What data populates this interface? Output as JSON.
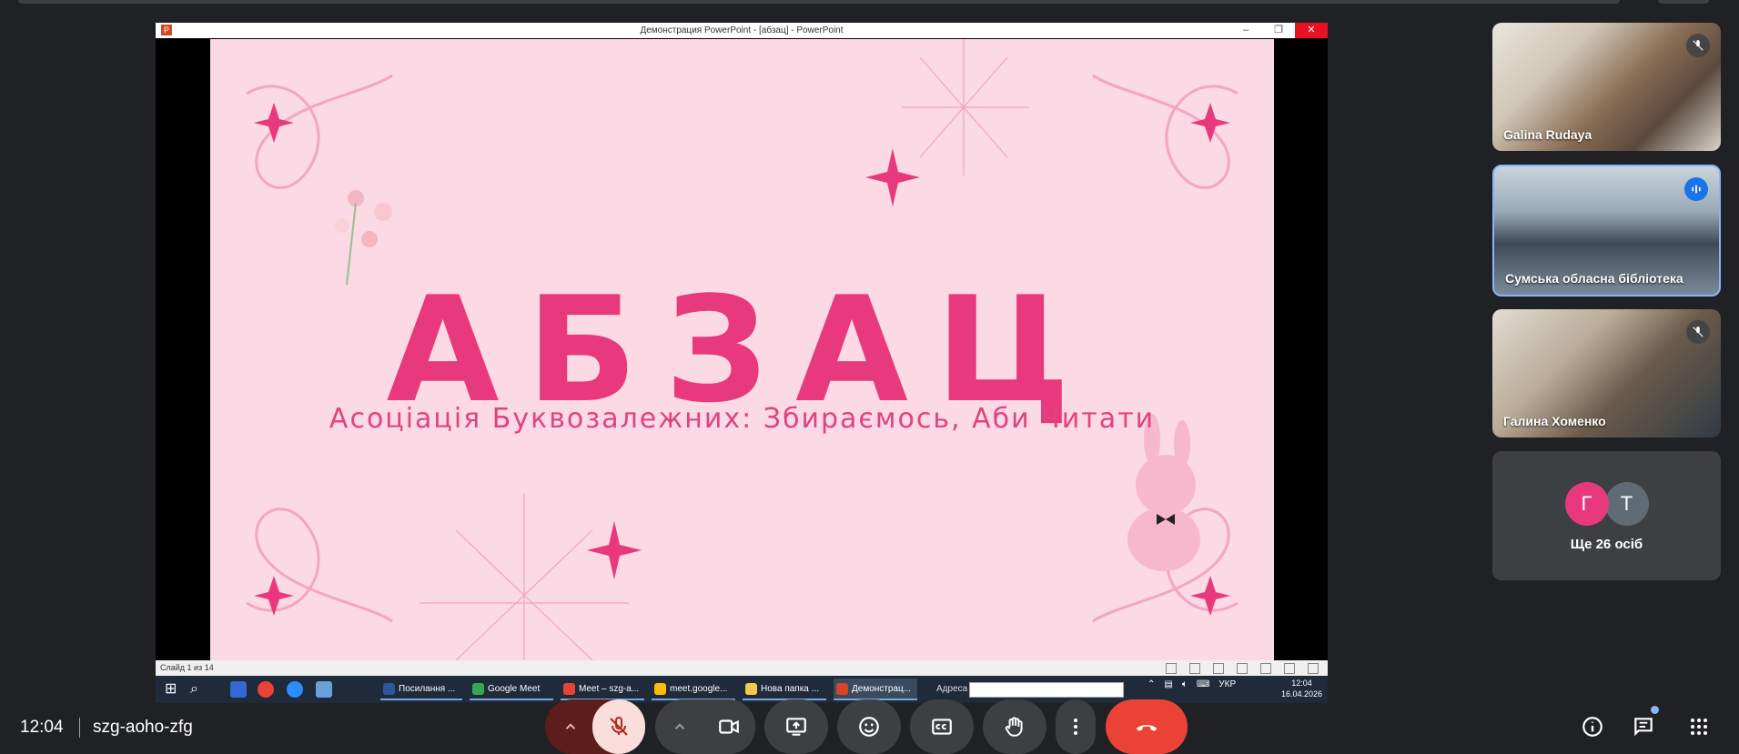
{
  "share": {
    "window_title": "Демонстрация PowerPoint - [абзац] - PowerPoint",
    "slide": {
      "title": "АБЗАЦ",
      "subtitle": "Асоціація Буквозалежних: Збираємось, Аби Читати"
    },
    "status": "Слайд 1 из 14",
    "taskbar": {
      "apps": [
        {
          "label": "Посилання ...",
          "color": "#2b579a"
        },
        {
          "label": "Google Meet",
          "color": "#34a853"
        },
        {
          "label": "Meet – szg-a...",
          "color": "#ea4335"
        },
        {
          "label": "meet.google...",
          "color": "#fbbc05"
        },
        {
          "label": "Нова папка ...",
          "color": "#f2c94c"
        },
        {
          "label": "Демонстрац...",
          "color": "#d24726"
        }
      ],
      "address_label": "Адреса",
      "language": "УКР",
      "time": "12:04",
      "date": "16.04.2026"
    }
  },
  "participants": [
    {
      "name": "Galina Rudaya",
      "muted": true
    },
    {
      "name": "Сумська обласна бібліотека",
      "speaking": true
    },
    {
      "name": "Галина Хоменко",
      "muted": true
    }
  ],
  "more_tile": {
    "avatar1": "Г",
    "avatar2": "Т",
    "label": "Ще 26 осіб"
  },
  "meeting": {
    "time": "12:04",
    "code": "szg-aoho-zfg"
  },
  "colors": {
    "background": "#202124",
    "mic_muted": "#f9dedc",
    "end_call": "#ea4335",
    "slide_accent": "#e8397d"
  }
}
